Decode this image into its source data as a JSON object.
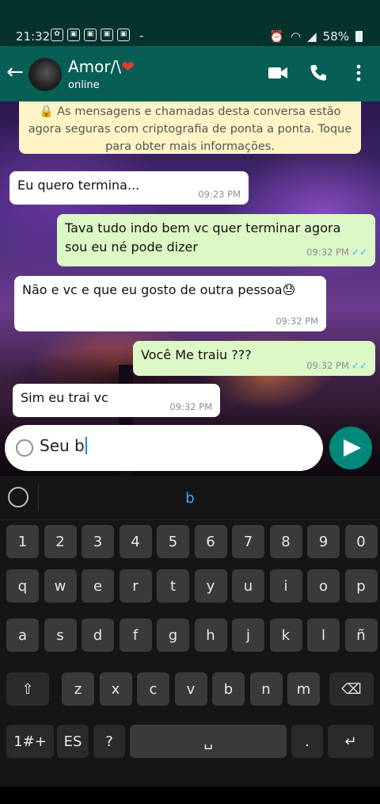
{
  "status_bar": {
    "time": "21:32",
    "battery": "58%",
    "dash": "-"
  },
  "header": {
    "back_icon": "back-arrow-icon",
    "contact_name": "Amor/\\",
    "heart": "❤",
    "status": "online",
    "actions": [
      "video-call-icon",
      "phone-call-icon",
      "more-options-icon"
    ]
  },
  "encryption_notice": "As mensagens e chamadas desta conversa estão agora seguras com criptografia de ponta a ponta. Toque para obter mais informações.",
  "messages": [
    {
      "direction": "in",
      "text": "Eu quero termina...",
      "time": "09:23 PM"
    },
    {
      "direction": "out",
      "text": "Tava tudo indo bem vc quer terminar agora sou eu né pode dizer",
      "time": "09:32 PM"
    },
    {
      "direction": "in",
      "text": "Não e vc e que eu gosto de outra pessoa😓",
      "time": "09:32 PM"
    },
    {
      "direction": "out",
      "text": "Você Me traiu ???",
      "time": "09:32 PM"
    },
    {
      "direction": "in",
      "text": "Sim eu trai vc",
      "time": "09:32 PM"
    }
  ],
  "composer": {
    "value": "Seu b"
  },
  "keyboard": {
    "suggestion": "b",
    "row_numbers": [
      "1",
      "2",
      "3",
      "4",
      "5",
      "6",
      "7",
      "8",
      "9",
      "0"
    ],
    "row1": [
      "q",
      "w",
      "e",
      "r",
      "t",
      "y",
      "u",
      "i",
      "o",
      "p"
    ],
    "row2": [
      "a",
      "s",
      "d",
      "f",
      "g",
      "h",
      "j",
      "k",
      "l",
      "ñ"
    ],
    "row3": [
      "z",
      "x",
      "c",
      "v",
      "b",
      "n",
      "m"
    ],
    "shift_icon": "⇧",
    "backspace_icon": "⌫",
    "symbols_label": "1#+",
    "language_label": "ES",
    "question_label": "?",
    "space_icon": "␣",
    "period_label": ".",
    "enter_icon": "↵"
  }
}
